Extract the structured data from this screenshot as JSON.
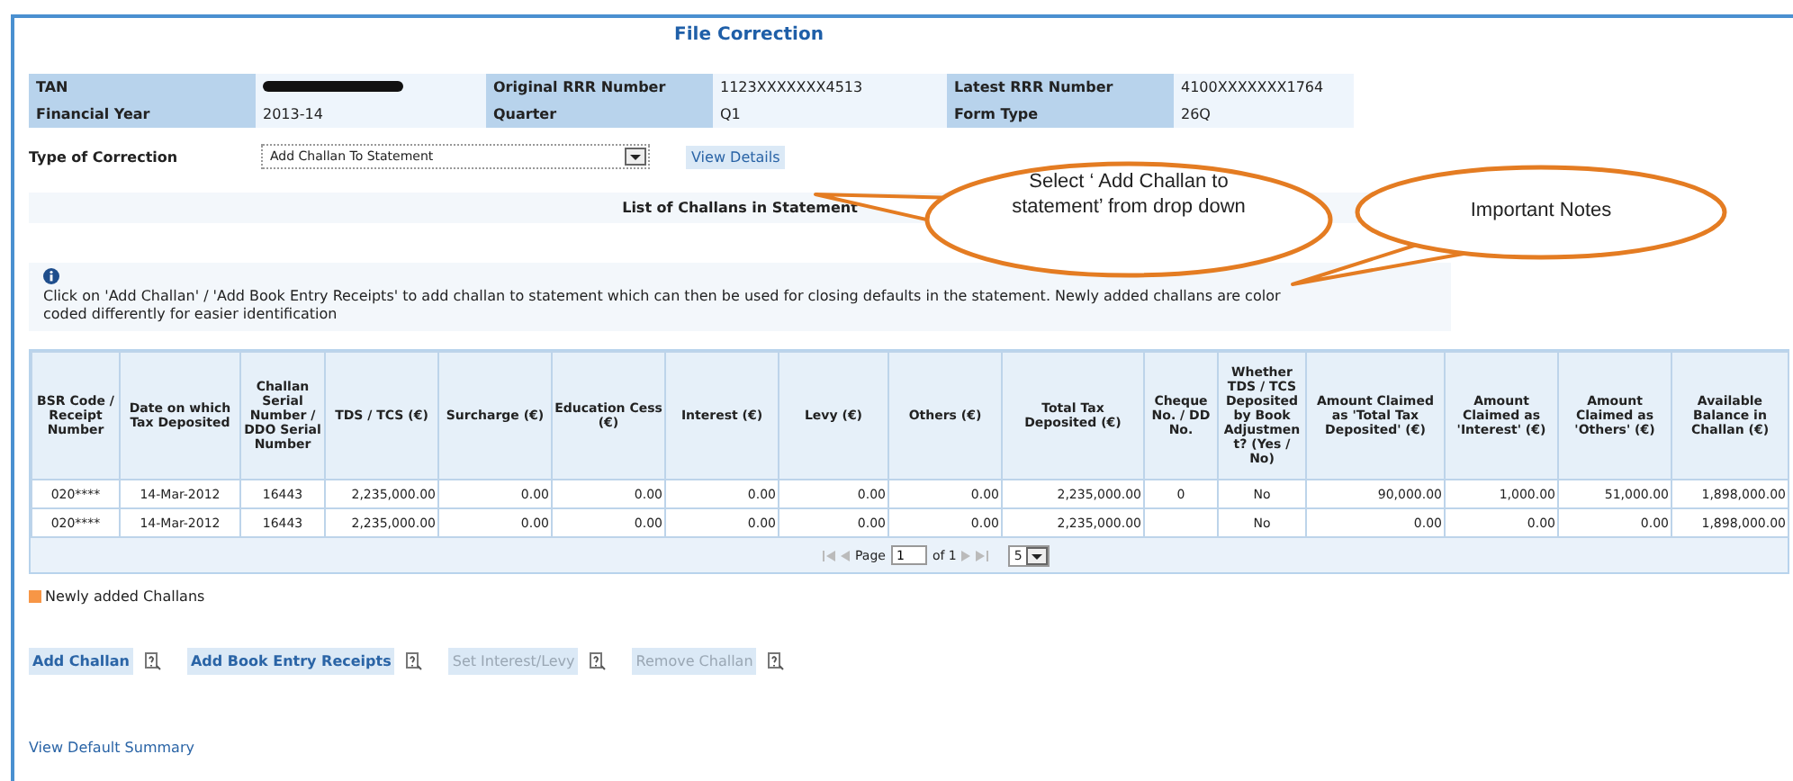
{
  "title": "File Correction",
  "info": [
    {
      "label": "TAN",
      "redacted": true
    },
    {
      "label": "Original RRR Number",
      "value": "1123XXXXXXX4513",
      "redacted": false
    },
    {
      "label": "Latest RRR Number",
      "value": "4100XXXXXXX1764",
      "redacted": false
    },
    {
      "label": "Financial Year",
      "value": "2013-14",
      "redacted": false
    },
    {
      "label": "Quarter",
      "value": "Q1",
      "redacted": false
    },
    {
      "label": "Form Type",
      "value": "26Q",
      "redacted": false
    }
  ],
  "correction": {
    "label": "Type of Correction",
    "value": "Add Challan To Statement",
    "button": "View Details"
  },
  "section_title": "List of Challans in Statement",
  "note": "Click on 'Add Challan' / 'Add Book Entry Receipts' to add challan to statement which can then be used for closing defaults in the statement. Newly added challans are color coded differently for easier identification",
  "table": {
    "columns": [
      "BSR Code / Receipt Number",
      "Date on which Tax Deposited",
      "Challan Serial Number / DDO Serial Number",
      "TDS / TCS (€)",
      "Surcharge (€)",
      "Education Cess (€)",
      "Interest (€)",
      "Levy (€)",
      "Others (€)",
      "Total Tax Deposited (€)",
      "Cheque No. / DD No.",
      "Whether TDS / TCS Deposited by Book Adjustmen t? (Yes / No)",
      "Amount Claimed as 'Total Tax Deposited' (€)",
      "Amount Claimed as 'Interest' (€)",
      "Amount Claimed as 'Others' (€)",
      "Available Balance in Challan (€)"
    ],
    "rows": [
      [
        "020****",
        "14-Mar-2012",
        "16443",
        "2,235,000.00",
        "0.00",
        "0.00",
        "0.00",
        "0.00",
        "0.00",
        "2,235,000.00",
        "0",
        "No",
        "90,000.00",
        "1,000.00",
        "51,000.00",
        "1,898,000.00"
      ],
      [
        "020****",
        "14-Mar-2012",
        "16443",
        "2,235,000.00",
        "0.00",
        "0.00",
        "0.00",
        "0.00",
        "0.00",
        "2,235,000.00",
        "",
        "No",
        "0.00",
        "0.00",
        "0.00",
        "1,898,000.00"
      ]
    ],
    "pager": {
      "page_label": "Page",
      "page": "1",
      "of": "of 1",
      "page_size": "5"
    }
  },
  "legend": {
    "label": "Newly added Challans",
    "color": "#f79646"
  },
  "actions": [
    {
      "label": "Add Challan",
      "disabled": false
    },
    {
      "label": "Add Book Entry Receipts",
      "disabled": false
    },
    {
      "label": "Set Interest/Levy",
      "disabled": true
    },
    {
      "label": "Remove Challan",
      "disabled": true
    }
  ],
  "link": "View Default Summary",
  "callouts": [
    {
      "text": "Select ‘ Add Challan to statement’ from drop down"
    },
    {
      "text": "Important Notes"
    }
  ]
}
